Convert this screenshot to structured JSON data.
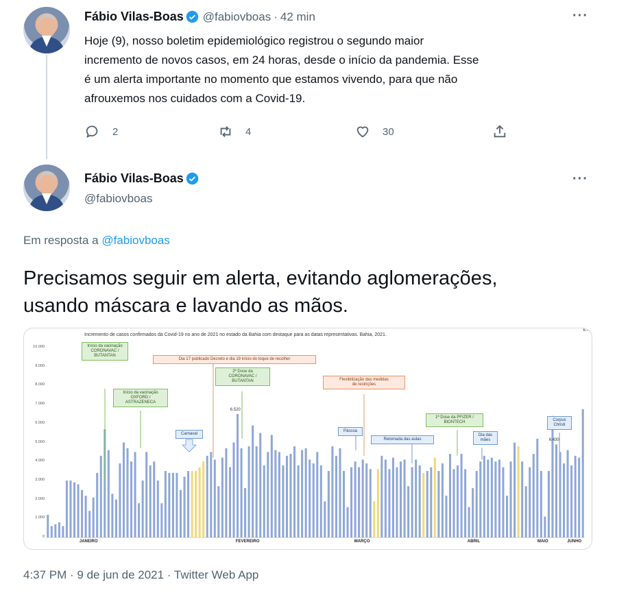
{
  "tweet1": {
    "name": "Fábio Vilas-Boas",
    "handle": "@fabiovboas",
    "separator": "·",
    "time": "42 min",
    "more": "···",
    "text_lines": [
      "Hoje (9), nosso boletim epidemiológico registrou o segundo maior",
      "incremento de novos casos, em 24 horas, desde o início da pandemia. Esse",
      "é um alerta importante no momento que estamos vivendo, para que não",
      "afrouxemos nos cuidados com a Covid-19."
    ],
    "replies": "2",
    "retweets": "4",
    "likes": "30"
  },
  "tweet2": {
    "name": "Fábio Vilas-Boas",
    "handle": "@fabiovboas",
    "more": "···",
    "reply_prefix": "Em resposta a",
    "reply_handle": "@fabiovboas",
    "text_lines": [
      "Precisamos seguir em alerta, evitando aglomerações,",
      "usando máscara e lavando as mãos."
    ],
    "footer": "4:37 PM · 9 de jun de 2021 · Twitter Web App"
  },
  "colors": {
    "bar": "#8ea7d6",
    "bar_highlight_yellow": "#f3d77a",
    "bar_highlight_orange": "#f2b37c",
    "link": "#1d9bf0",
    "verified": "#1d9bf0"
  },
  "chart_data": {
    "type": "bar",
    "title": "Incremento de casos confirmados da Covid-19 no ano de 2021 no estado da Bahia com destaque para as datas representativas. Bahia, 2021.",
    "yticks": [
      "10.000",
      "9.000",
      "8.000",
      "7.000",
      "6.000",
      "5.000",
      "4.000",
      "3.000",
      "2.000",
      "1.000",
      "0"
    ],
    "ylim": [
      0,
      10000
    ],
    "months": [
      "JANEIRO",
      "FEVEREIRO",
      "MARÇO",
      "ABRIL",
      "MAIO",
      "JUNHO"
    ],
    "values": [
      1200,
      600,
      700,
      800,
      600,
      3000,
      3000,
      2900,
      2800,
      2500,
      2200,
      1400,
      2100,
      3400,
      4300,
      5700,
      4600,
      2300,
      2000,
      3900,
      5000,
      4700,
      4000,
      4500,
      1800,
      3000,
      4500,
      3800,
      4000,
      3000,
      1800,
      3500,
      3400,
      3400,
      3400,
      2500,
      3200,
      3500,
      3500,
      3500,
      3700,
      4000,
      4300,
      4500,
      4100,
      2700,
      4200,
      4700,
      3700,
      5000,
      6500,
      4700,
      2600,
      4800,
      5900,
      4800,
      5500,
      3800,
      4500,
      5400,
      4600,
      4500,
      3800,
      4300,
      4400,
      4800,
      3800,
      4600,
      4700,
      4100,
      3900,
      4500,
      3800,
      1900,
      3500,
      4800,
      4300,
      4700,
      3500,
      1600,
      3700,
      4000,
      3700,
      4100,
      3900,
      3600,
      1900,
      3600,
      4300,
      4100,
      3600,
      4200,
      3700,
      4000,
      4100,
      2700,
      3700,
      4100,
      3800,
      3400,
      3500,
      3700,
      4200,
      3500,
      3900,
      2200,
      4400,
      3600,
      3800,
      4400,
      3600,
      1600,
      2600,
      3500,
      4000,
      4300,
      4100,
      4200,
      4000,
      4100,
      3700,
      2200,
      4000,
      5000,
      4800,
      4000,
      2700,
      3700,
      4400,
      5200,
      3500,
      1100,
      3500,
      6400,
      4900,
      4500,
      3900,
      4600,
      3800,
      4300,
      4200,
      6760
    ],
    "highlight_yellow": [
      38,
      39,
      40,
      41,
      86,
      87,
      99,
      102,
      124
    ],
    "value_labels": [
      {
        "index": 50,
        "label": "6.520"
      },
      {
        "index": 134,
        "label": "6.430"
      },
      {
        "index": 143,
        "label": "6.762"
      }
    ],
    "annotations": {
      "vac1": "Início da vacinação\nCORONAVAC /\nBUTANTAN",
      "vac2": "Início da vacinação\nOXFORD /\nASTRAZENECA",
      "decreto": "Dia 17 publicado Decreto e dia 19 início do toque de recolher",
      "dose2": "2ª Dose da\nCORONAVAC /\nBUTANTAN",
      "carnaval": "Carnaval",
      "flex": "Flexibilização das medidas\nde restrições",
      "pascoa": "Páscoa",
      "aulas": "Retomada das aulas",
      "pfizer": "1ª Dose da PFIZER /\nBIONTECH",
      "maes": "Dia das\nmães",
      "corpus": "Corpus\nChristi"
    }
  }
}
